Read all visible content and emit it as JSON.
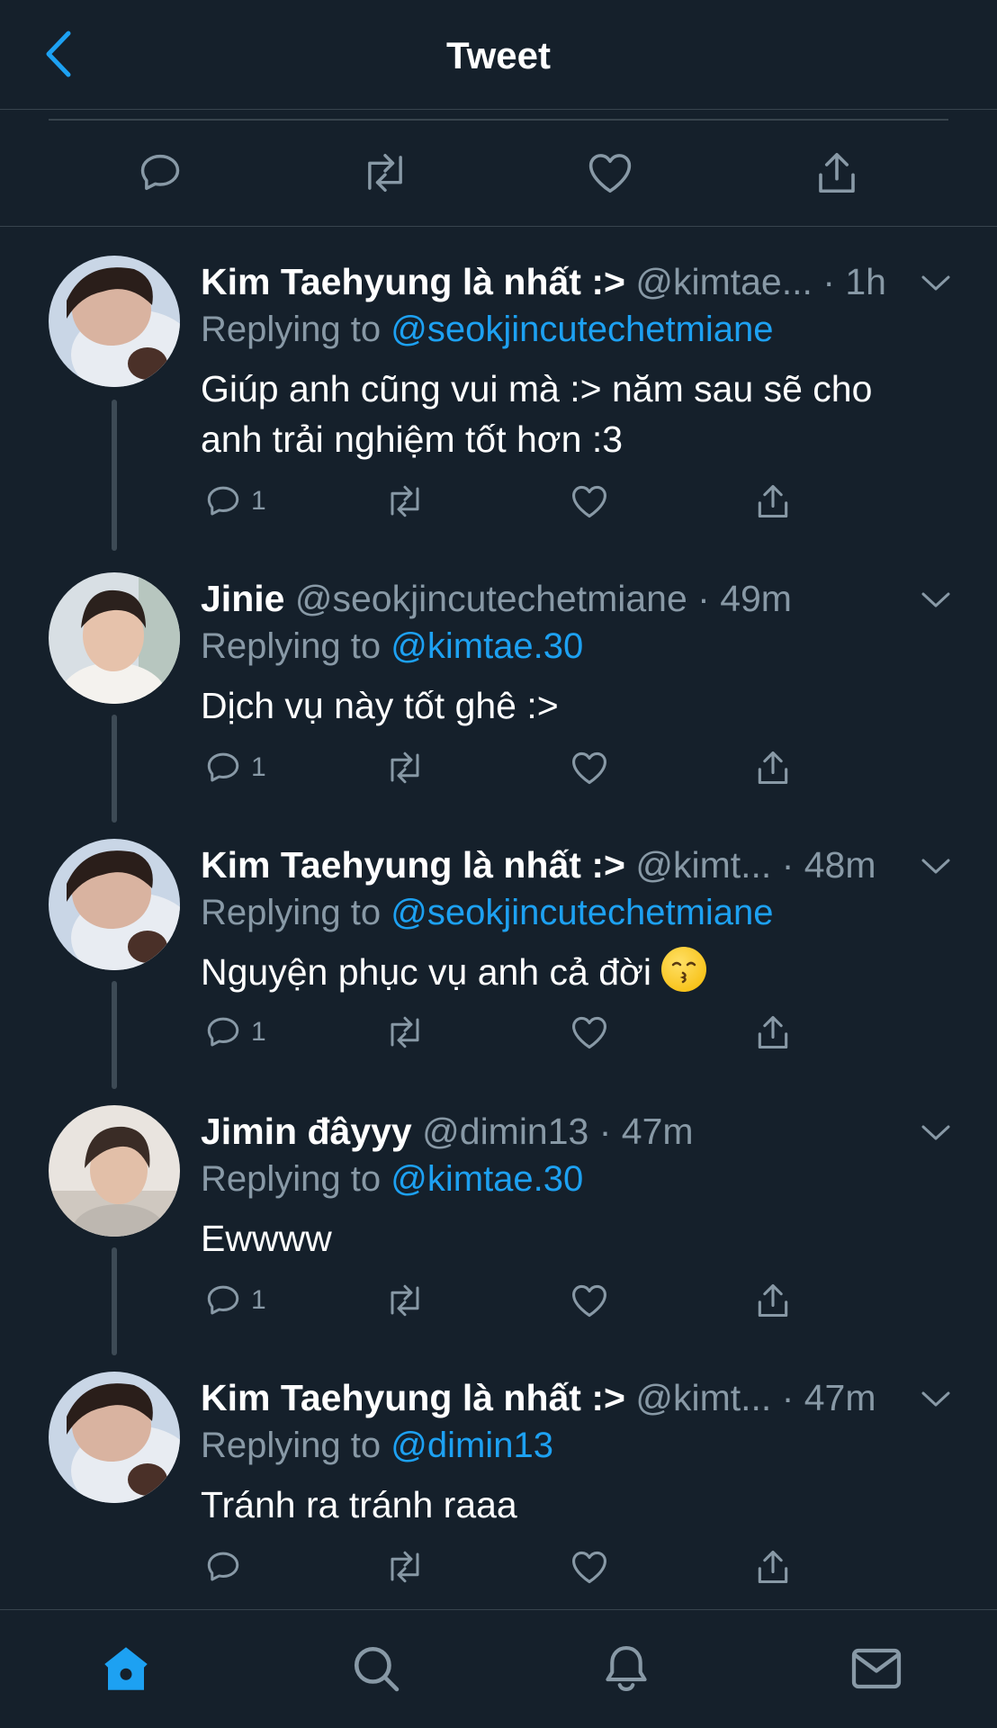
{
  "header": {
    "title": "Tweet",
    "back_icon": "chevron-left-icon"
  },
  "colors": {
    "background": "#15202b",
    "accent": "#1da1f2",
    "muted": "#8899a6",
    "divider": "#38444d"
  },
  "replies": [
    {
      "name": "Kim Taehyung là nhất :>",
      "handle": "@kimtae...",
      "time": "1h",
      "replying_prefix": "Replying to",
      "replying_to": "@seokjincutechetmiane",
      "text": "Giúp anh cũng vui mà :> năm sau sẽ cho anh trải nghiệm tốt hơn :3",
      "reply_count": "1"
    },
    {
      "name": "Jinie",
      "handle": "@seokjincutechetmiane",
      "time": "49m",
      "replying_prefix": "Replying to",
      "replying_to": "@kimtae.30",
      "text": "Dịch vụ này tốt ghê :>",
      "reply_count": "1"
    },
    {
      "name": "Kim Taehyung là nhất :>",
      "handle": "@kimt...",
      "time": "48m",
      "replying_prefix": "Replying to",
      "replying_to": "@seokjincutechetmiane",
      "text": "Nguyện phục vụ anh cả đời",
      "reply_count": "1"
    },
    {
      "name": "Jimin đâyyy",
      "handle": "@dimin13",
      "time": "47m",
      "replying_prefix": "Replying to",
      "replying_to": "@kimtae.30",
      "text": "Ewwww",
      "reply_count": "1"
    },
    {
      "name": "Kim Taehyung là nhất :>",
      "handle": "@kimt...",
      "time": "47m",
      "replying_prefix": "Replying to",
      "replying_to": "@dimin13",
      "text": "Tránh ra tránh raaa",
      "reply_count": ""
    }
  ],
  "separator": " · ",
  "tabs": [
    "home-icon",
    "search-icon",
    "bell-icon",
    "mail-icon"
  ]
}
